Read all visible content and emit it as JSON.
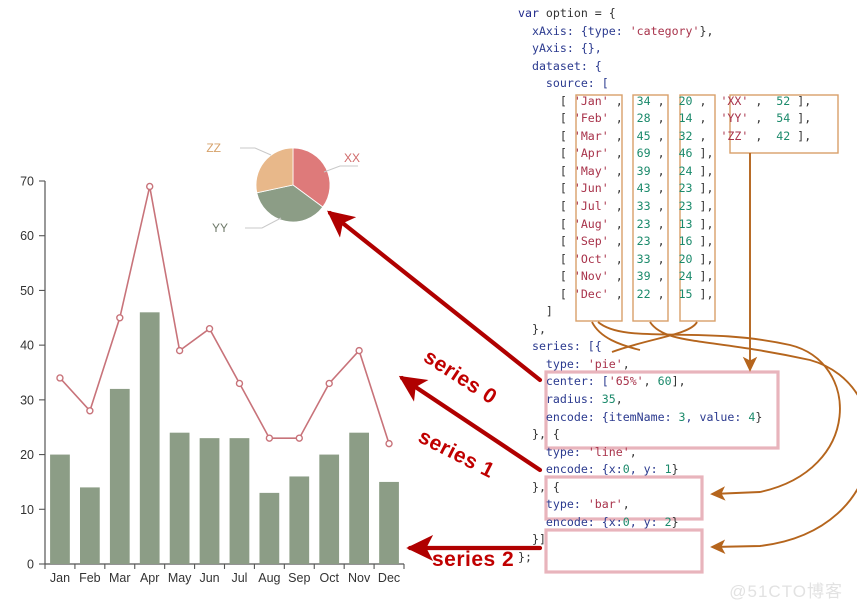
{
  "watermark": "@51CTO博客",
  "series_annotations": [
    {
      "id": "series-0",
      "label": "series 0",
      "target": "pie-chart"
    },
    {
      "id": "series-1",
      "label": "series 1",
      "target": "line-series"
    },
    {
      "id": "series-2",
      "label": "series 2",
      "target": "bar-series"
    }
  ],
  "code": {
    "lines": [
      [
        {
          "t": "var",
          "c": "kw"
        },
        {
          "t": " option ",
          "c": "pun"
        },
        {
          "t": "= {",
          "c": "pun"
        }
      ],
      [
        {
          "t": "  xAxis: {type: ",
          "c": "prop"
        },
        {
          "t": "'category'",
          "c": "str"
        },
        {
          "t": "},",
          "c": "pun"
        }
      ],
      [
        {
          "t": "  yAxis: {},",
          "c": "prop"
        }
      ],
      [
        {
          "t": "  dataset: {",
          "c": "prop"
        }
      ],
      [
        {
          "t": "    source: [",
          "c": "prop"
        }
      ],
      [
        {
          "t": "      [ ",
          "c": "pun"
        },
        {
          "t": "'Jan'",
          "c": "str"
        },
        {
          "t": " ,  ",
          "c": "pun"
        },
        {
          "t": "34",
          "c": "num"
        },
        {
          "t": " ,  ",
          "c": "pun"
        },
        {
          "t": "20",
          "c": "num"
        },
        {
          "t": " ,  ",
          "c": "pun"
        },
        {
          "t": "'XX'",
          "c": "str"
        },
        {
          "t": " ,  ",
          "c": "pun"
        },
        {
          "t": "52",
          "c": "num"
        },
        {
          "t": " ],",
          "c": "pun"
        }
      ],
      [
        {
          "t": "      [ ",
          "c": "pun"
        },
        {
          "t": "'Feb'",
          "c": "str"
        },
        {
          "t": " ,  ",
          "c": "pun"
        },
        {
          "t": "28",
          "c": "num"
        },
        {
          "t": " ,  ",
          "c": "pun"
        },
        {
          "t": "14",
          "c": "num"
        },
        {
          "t": " ,  ",
          "c": "pun"
        },
        {
          "t": "'YY'",
          "c": "str"
        },
        {
          "t": " ,  ",
          "c": "pun"
        },
        {
          "t": "54",
          "c": "num"
        },
        {
          "t": " ],",
          "c": "pun"
        }
      ],
      [
        {
          "t": "      [ ",
          "c": "pun"
        },
        {
          "t": "'Mar'",
          "c": "str"
        },
        {
          "t": " ,  ",
          "c": "pun"
        },
        {
          "t": "45",
          "c": "num"
        },
        {
          "t": " ,  ",
          "c": "pun"
        },
        {
          "t": "32",
          "c": "num"
        },
        {
          "t": " ,  ",
          "c": "pun"
        },
        {
          "t": "'ZZ'",
          "c": "str"
        },
        {
          "t": " ,  ",
          "c": "pun"
        },
        {
          "t": "42",
          "c": "num"
        },
        {
          "t": " ],",
          "c": "pun"
        }
      ],
      [
        {
          "t": "      [ ",
          "c": "pun"
        },
        {
          "t": "'Apr'",
          "c": "str"
        },
        {
          "t": " ,  ",
          "c": "pun"
        },
        {
          "t": "69",
          "c": "num"
        },
        {
          "t": " ,  ",
          "c": "pun"
        },
        {
          "t": "46",
          "c": "num"
        },
        {
          "t": " ],",
          "c": "pun"
        }
      ],
      [
        {
          "t": "      [ ",
          "c": "pun"
        },
        {
          "t": "'May'",
          "c": "str"
        },
        {
          "t": " ,  ",
          "c": "pun"
        },
        {
          "t": "39",
          "c": "num"
        },
        {
          "t": " ,  ",
          "c": "pun"
        },
        {
          "t": "24",
          "c": "num"
        },
        {
          "t": " ],",
          "c": "pun"
        }
      ],
      [
        {
          "t": "      [ ",
          "c": "pun"
        },
        {
          "t": "'Jun'",
          "c": "str"
        },
        {
          "t": " ,  ",
          "c": "pun"
        },
        {
          "t": "43",
          "c": "num"
        },
        {
          "t": " ,  ",
          "c": "pun"
        },
        {
          "t": "23",
          "c": "num"
        },
        {
          "t": " ],",
          "c": "pun"
        }
      ],
      [
        {
          "t": "      [ ",
          "c": "pun"
        },
        {
          "t": "'Jul'",
          "c": "str"
        },
        {
          "t": " ,  ",
          "c": "pun"
        },
        {
          "t": "33",
          "c": "num"
        },
        {
          "t": " ,  ",
          "c": "pun"
        },
        {
          "t": "23",
          "c": "num"
        },
        {
          "t": " ],",
          "c": "pun"
        }
      ],
      [
        {
          "t": "      [ ",
          "c": "pun"
        },
        {
          "t": "'Aug'",
          "c": "str"
        },
        {
          "t": " ,  ",
          "c": "pun"
        },
        {
          "t": "23",
          "c": "num"
        },
        {
          "t": " ,  ",
          "c": "pun"
        },
        {
          "t": "13",
          "c": "num"
        },
        {
          "t": " ],",
          "c": "pun"
        }
      ],
      [
        {
          "t": "      [ ",
          "c": "pun"
        },
        {
          "t": "'Sep'",
          "c": "str"
        },
        {
          "t": " ,  ",
          "c": "pun"
        },
        {
          "t": "23",
          "c": "num"
        },
        {
          "t": " ,  ",
          "c": "pun"
        },
        {
          "t": "16",
          "c": "num"
        },
        {
          "t": " ],",
          "c": "pun"
        }
      ],
      [
        {
          "t": "      [ ",
          "c": "pun"
        },
        {
          "t": "'Oct'",
          "c": "str"
        },
        {
          "t": " ,  ",
          "c": "pun"
        },
        {
          "t": "33",
          "c": "num"
        },
        {
          "t": " ,  ",
          "c": "pun"
        },
        {
          "t": "20",
          "c": "num"
        },
        {
          "t": " ],",
          "c": "pun"
        }
      ],
      [
        {
          "t": "      [ ",
          "c": "pun"
        },
        {
          "t": "'Nov'",
          "c": "str"
        },
        {
          "t": " ,  ",
          "c": "pun"
        },
        {
          "t": "39",
          "c": "num"
        },
        {
          "t": " ,  ",
          "c": "pun"
        },
        {
          "t": "24",
          "c": "num"
        },
        {
          "t": " ],",
          "c": "pun"
        }
      ],
      [
        {
          "t": "      [ ",
          "c": "pun"
        },
        {
          "t": "'Dec'",
          "c": "str"
        },
        {
          "t": " ,  ",
          "c": "pun"
        },
        {
          "t": "22",
          "c": "num"
        },
        {
          "t": " ,  ",
          "c": "pun"
        },
        {
          "t": "15",
          "c": "num"
        },
        {
          "t": " ],",
          "c": "pun"
        }
      ],
      [
        {
          "t": "    ]",
          "c": "pun"
        }
      ],
      [
        {
          "t": "  },",
          "c": "pun"
        }
      ],
      [
        {
          "t": "  series: [{",
          "c": "prop"
        }
      ],
      [
        {
          "t": "    type: ",
          "c": "prop"
        },
        {
          "t": "'pie'",
          "c": "str"
        },
        {
          "t": ",",
          "c": "pun"
        }
      ],
      [
        {
          "t": "    center: [",
          "c": "prop"
        },
        {
          "t": "'65%'",
          "c": "str"
        },
        {
          "t": ", ",
          "c": "pun"
        },
        {
          "t": "60",
          "c": "num"
        },
        {
          "t": "],",
          "c": "pun"
        }
      ],
      [
        {
          "t": "    radius: ",
          "c": "prop"
        },
        {
          "t": "35",
          "c": "num"
        },
        {
          "t": ",",
          "c": "pun"
        }
      ],
      [
        {
          "t": "    encode: {itemName: ",
          "c": "prop"
        },
        {
          "t": "3",
          "c": "num"
        },
        {
          "t": ", value: ",
          "c": "prop"
        },
        {
          "t": "4",
          "c": "num"
        },
        {
          "t": "}",
          "c": "pun"
        }
      ],
      [
        {
          "t": "  }, {",
          "c": "pun"
        }
      ],
      [
        {
          "t": "    type: ",
          "c": "prop"
        },
        {
          "t": "'line'",
          "c": "str"
        },
        {
          "t": ",",
          "c": "pun"
        }
      ],
      [
        {
          "t": "    encode: {x:",
          "c": "prop"
        },
        {
          "t": "0",
          "c": "num"
        },
        {
          "t": ", y: ",
          "c": "prop"
        },
        {
          "t": "1",
          "c": "num"
        },
        {
          "t": "}",
          "c": "pun"
        }
      ],
      [
        {
          "t": "  }, {",
          "c": "pun"
        }
      ],
      [
        {
          "t": "    type: ",
          "c": "prop"
        },
        {
          "t": "'bar'",
          "c": "str"
        },
        {
          "t": ",",
          "c": "pun"
        }
      ],
      [
        {
          "t": "    encode: {x:",
          "c": "prop"
        },
        {
          "t": "0",
          "c": "num"
        },
        {
          "t": ", y: ",
          "c": "prop"
        },
        {
          "t": "2",
          "c": "num"
        },
        {
          "t": "}",
          "c": "pun"
        }
      ],
      [
        {
          "t": "  }]",
          "c": "pun"
        }
      ],
      [
        {
          "t": "};",
          "c": "pun"
        }
      ]
    ],
    "option_source_rows": [
      {
        "month": "Jan",
        "line": 34,
        "bar": 20,
        "pie_name": "XX",
        "pie_value": 52
      },
      {
        "month": "Feb",
        "line": 28,
        "bar": 14,
        "pie_name": "YY",
        "pie_value": 54
      },
      {
        "month": "Mar",
        "line": 45,
        "bar": 32,
        "pie_name": "ZZ",
        "pie_value": 42
      },
      {
        "month": "Apr",
        "line": 69,
        "bar": 46
      },
      {
        "month": "May",
        "line": 39,
        "bar": 24
      },
      {
        "month": "Jun",
        "line": 43,
        "bar": 23
      },
      {
        "month": "Jul",
        "line": 33,
        "bar": 23
      },
      {
        "month": "Aug",
        "line": 23,
        "bar": 13
      },
      {
        "month": "Sep",
        "line": 23,
        "bar": 16
      },
      {
        "month": "Oct",
        "line": 33,
        "bar": 20
      },
      {
        "month": "Nov",
        "line": 39,
        "bar": 24
      },
      {
        "month": "Dec",
        "line": 22,
        "bar": 15
      }
    ],
    "series_defs": [
      {
        "index": 0,
        "type": "pie",
        "center": [
          "65%",
          60
        ],
        "radius": 35,
        "encode": {
          "itemName": 3,
          "value": 4
        }
      },
      {
        "index": 1,
        "type": "line",
        "encode": {
          "x": 0,
          "y": 1
        }
      },
      {
        "index": 2,
        "type": "bar",
        "encode": {
          "x": 0,
          "y": 2
        }
      }
    ]
  },
  "chart_data": {
    "type": "bar",
    "title": "",
    "xlabel": "",
    "ylabel": "",
    "categories": [
      "Jan",
      "Feb",
      "Mar",
      "Apr",
      "May",
      "Jun",
      "Jul",
      "Aug",
      "Sep",
      "Oct",
      "Nov",
      "Dec"
    ],
    "ylim": [
      0,
      70
    ],
    "yticks": [
      0,
      10,
      20,
      30,
      40,
      50,
      60,
      70
    ],
    "grid": false,
    "legend": "none",
    "series": [
      {
        "name": "series 2",
        "type": "bar",
        "values": [
          20,
          14,
          32,
          46,
          24,
          23,
          23,
          13,
          16,
          20,
          24,
          15
        ],
        "color": "#8c9d86"
      },
      {
        "name": "series 1",
        "type": "line",
        "values": [
          34,
          28,
          45,
          69,
          39,
          43,
          33,
          23,
          23,
          33,
          39,
          22
        ],
        "color": "#c8737a"
      }
    ],
    "pie": {
      "name": "series 0",
      "type": "pie",
      "labels": [
        "XX",
        "YY",
        "ZZ"
      ],
      "values": [
        52,
        54,
        42
      ],
      "colors": [
        "#de7a7a",
        "#8c9d86",
        "#e8b88a"
      ]
    }
  },
  "colors": {
    "bar": "#8c9d86",
    "line": "#c8737a",
    "pie_xx": "#de7a7a",
    "pie_yy": "#8c9d86",
    "pie_zz": "#e8b88a",
    "annotation_arrow": "#b00000",
    "flow_curve": "#b5651d",
    "highlight_box_data": "#d9a06a",
    "highlight_box_series": "#e8b4bc",
    "series_label": "#c00000",
    "axis": "#555555"
  }
}
